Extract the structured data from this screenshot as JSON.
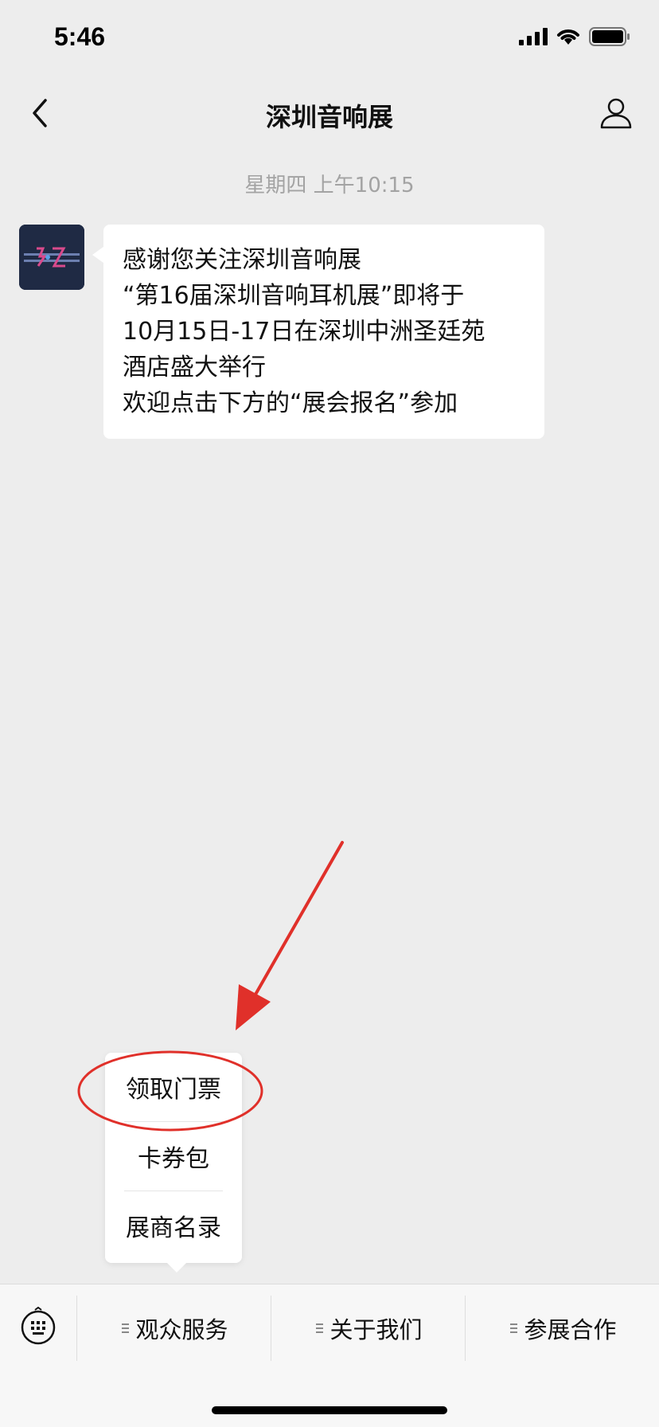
{
  "status_bar": {
    "time": "5:46"
  },
  "nav": {
    "title": "深圳音响展"
  },
  "chat": {
    "timestamp": "星期四 上午10:15",
    "message_lines": [
      "感谢您关注深圳音响展",
      "“第16届深圳音响耳机展”即将于",
      "10月15日-17日在深圳中洲圣廷苑",
      "酒店盛大举行",
      "欢迎点击下方的“展会报名”参加"
    ]
  },
  "popup_menu": {
    "items": [
      "领取门票",
      "卡券包",
      "展商名录"
    ]
  },
  "bottom_menu": {
    "items": [
      "观众服务",
      "关于我们",
      "参展合作"
    ]
  },
  "annotation": {
    "color": "#e0302a"
  },
  "icons": {
    "back": "chevron-left-icon",
    "profile": "person-icon",
    "keyboard": "keyboard-icon",
    "menu": "menu-lines-icon"
  }
}
